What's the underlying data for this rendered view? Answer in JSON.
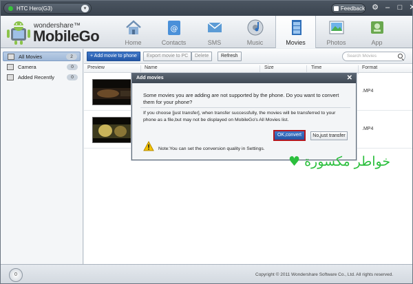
{
  "titlebar": {
    "device_name": "HTC Hero(G3)",
    "feedback_label": "Feedback",
    "controls": [
      {
        "icon": "gear-icon",
        "glyph": "⚙"
      },
      {
        "icon": "minimize-icon",
        "glyph": "–"
      },
      {
        "icon": "maximize-icon",
        "glyph": "□"
      },
      {
        "icon": "close-icon",
        "glyph": "✕"
      }
    ]
  },
  "logo": {
    "small_text": "wondershare™",
    "big_text": "MobileGo"
  },
  "nav": {
    "tabs": [
      {
        "label": "Home",
        "icon": "home-icon",
        "active": false
      },
      {
        "label": "Contacts",
        "icon": "contacts-icon",
        "active": false
      },
      {
        "label": "SMS",
        "icon": "sms-icon",
        "active": false
      },
      {
        "label": "Music",
        "icon": "music-icon",
        "active": false
      },
      {
        "label": "Movies",
        "icon": "movies-icon",
        "active": true
      },
      {
        "label": "Photos",
        "icon": "photos-icon",
        "active": false
      },
      {
        "label": "App",
        "icon": "app-icon",
        "active": false
      }
    ]
  },
  "sidebar": {
    "items": [
      {
        "label": "All Movies",
        "count": "2",
        "active": true
      },
      {
        "label": "Camera",
        "count": "0",
        "active": false
      },
      {
        "label": "Added Recently",
        "count": "0",
        "active": false
      }
    ]
  },
  "actions": {
    "add_label": "+ Add movie to phone",
    "export_label": "Export movie to PC",
    "delete_label": "Delete",
    "refresh_label": "Refresh",
    "search_placeholder": "Search Movies"
  },
  "table": {
    "columns": [
      "Preview",
      "Name",
      "Size",
      "Time",
      "Format"
    ],
    "rows": [
      {
        "format": ".MP4"
      },
      {
        "format": ".MP4"
      }
    ]
  },
  "dialog": {
    "title": "Add movies",
    "message": "Some movies you are adding are not supported by the phone. Do you want to convert them for your phone?",
    "detail": "If you choose [just transfer], when transfer successfully, the movies will be transferred to your phone as a file,but may not be displayed on MobileGo's All Movies list.",
    "ok_label": "OK,convert",
    "no_label": "No,just transfer",
    "note": "Note:You can set the conversion quality in Settings."
  },
  "status": {
    "disc_label": "0",
    "copyright": "Copyright © 2011 Wondershare Software Co., Ltd. All rights reserved."
  },
  "watermark": {
    "text": "خواطر مكسورة ♥"
  },
  "colors": {
    "accent": "#2457a6",
    "titlebar": "#3a434e",
    "ok_outline": "#b3161e",
    "watermark": "#2bbf3d"
  }
}
